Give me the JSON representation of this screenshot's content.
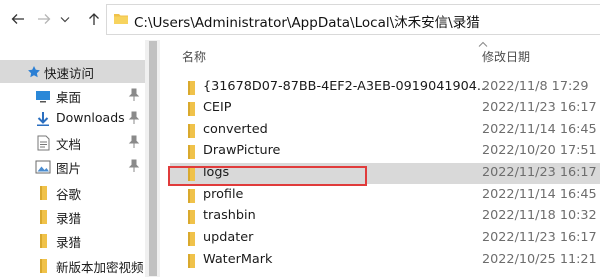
{
  "address_bar": {
    "back_icon": "arrow-left-icon",
    "forward_icon": "arrow-right-icon",
    "recent_icon": "chevron-down-icon",
    "up_icon": "arrow-up-icon",
    "path": "C:\\Users\\Administrator\\AppData\\Local\\沐禾安信\\录猎"
  },
  "nav_pane": {
    "items": [
      {
        "label": "快速访问",
        "icon": "star-icon"
      },
      {
        "label": "桌面",
        "icon": "desktop-icon",
        "pinned": true
      },
      {
        "label": "Downloads",
        "icon": "download-icon",
        "pinned": true
      },
      {
        "label": "文档",
        "icon": "document-icon",
        "pinned": true
      },
      {
        "label": "图片",
        "icon": "picture-icon",
        "pinned": true
      },
      {
        "label": "谷歌",
        "icon": "folder-icon"
      },
      {
        "label": "录猎",
        "icon": "folder-icon"
      },
      {
        "label": "录猎",
        "icon": "folder-icon"
      },
      {
        "label": "新版本加密视频",
        "icon": "folder-icon"
      }
    ]
  },
  "columns": {
    "name": "名称",
    "modified": "修改日期"
  },
  "files": [
    {
      "name": "{31678D07-87BB-4EF2-A3EB-0919041904...",
      "modified": "2022/11/8 17:29"
    },
    {
      "name": "CEIP",
      "modified": "2022/11/23 16:17"
    },
    {
      "name": "converted",
      "modified": "2022/11/14 16:45"
    },
    {
      "name": "DrawPicture",
      "modified": "2022/10/20 17:51"
    },
    {
      "name": "logs",
      "modified": "2022/11/23 16:17"
    },
    {
      "name": "profile",
      "modified": "2022/11/14 16:45"
    },
    {
      "name": "trashbin",
      "modified": "2022/11/18 10:32"
    },
    {
      "name": "updater",
      "modified": "2022/11/23 16:17"
    },
    {
      "name": "WaterMark",
      "modified": "2022/10/25 11:21"
    }
  ],
  "colors": {
    "folder": "#f0c24a",
    "selection": "#d9d9d9",
    "highlight_box": "#e03b3b",
    "pin": "#8a8a8a"
  }
}
